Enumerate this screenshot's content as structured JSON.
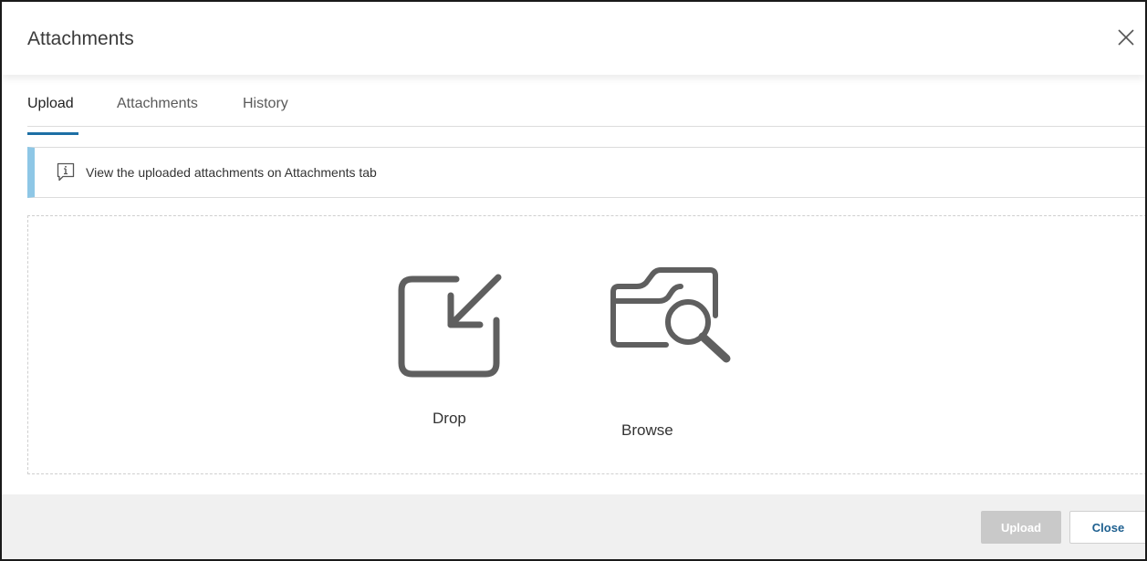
{
  "dialog": {
    "title": "Attachments"
  },
  "tabs": [
    {
      "label": "Upload",
      "active": true
    },
    {
      "label": "Attachments",
      "active": false
    },
    {
      "label": "History",
      "active": false
    }
  ],
  "info_banner": {
    "text": "View the uploaded attachments on Attachments tab",
    "icon": "info-icon",
    "accent_color": "#8ec7e6"
  },
  "drop_zone": {
    "drop_label": "Drop",
    "browse_label": "Browse"
  },
  "footer": {
    "upload_label": "Upload",
    "close_label": "Close",
    "upload_enabled": false
  },
  "colors": {
    "tab_accent": "#1d6fa5",
    "close_text": "#1d5f8f",
    "footer_bg": "#f0f0f0"
  }
}
